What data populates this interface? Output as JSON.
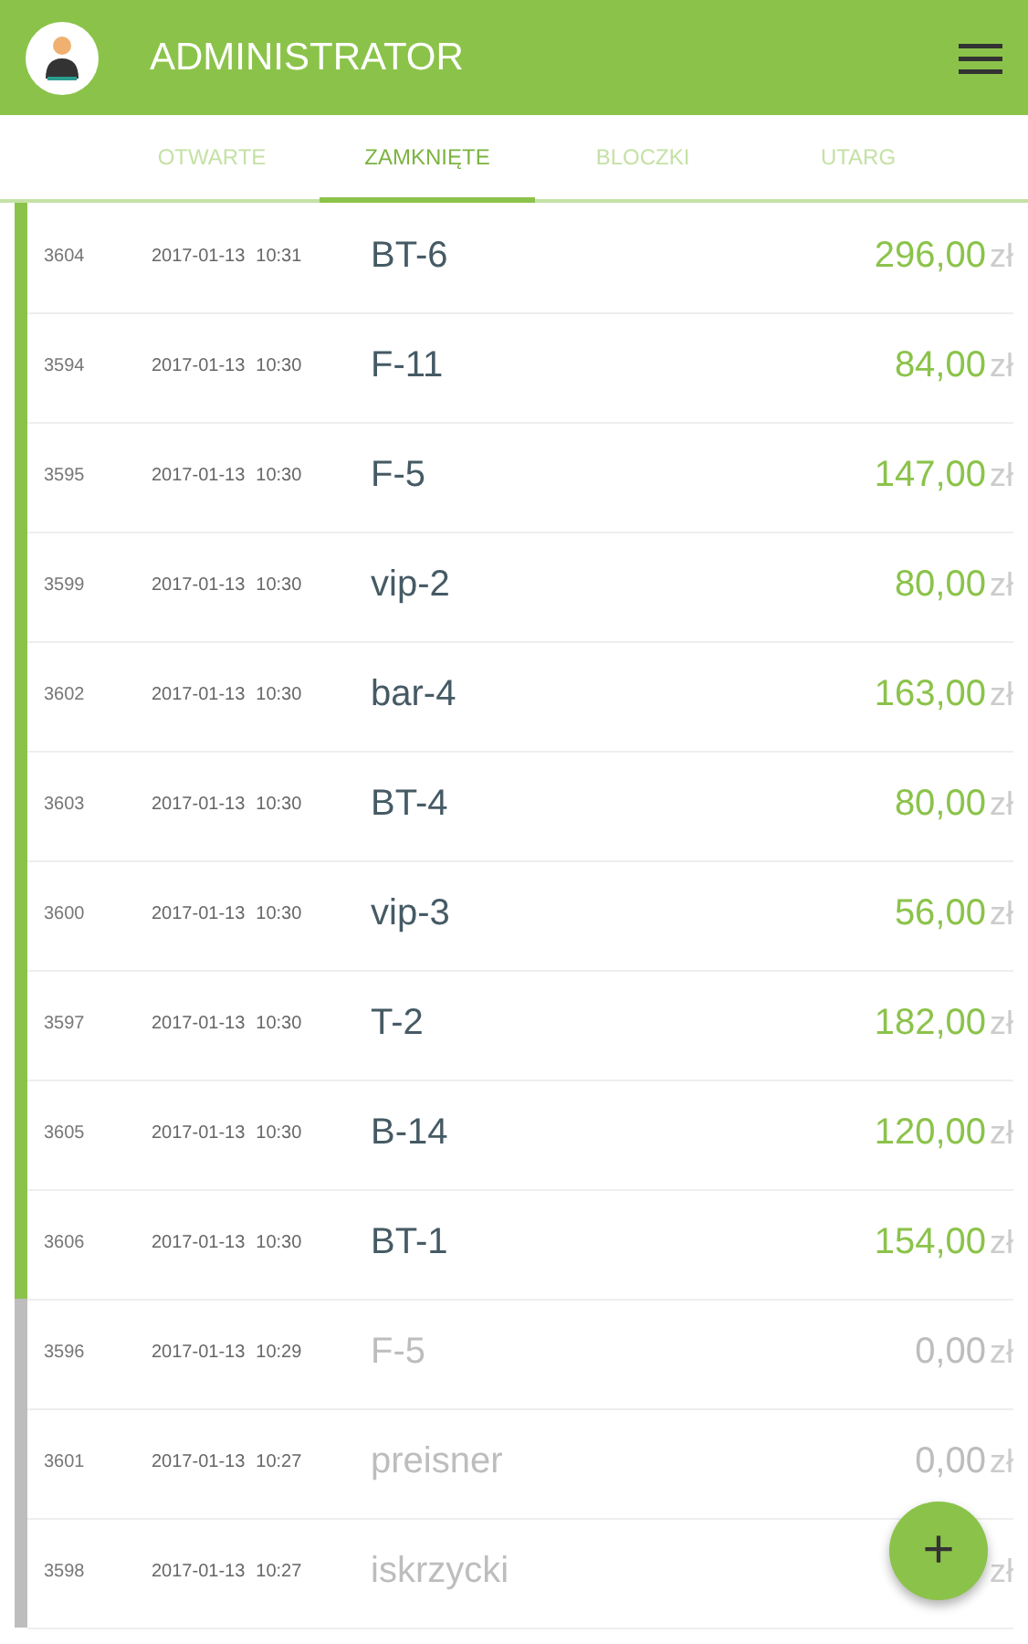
{
  "app_bar": {
    "title": "ADMINISTRATOR"
  },
  "tabs": [
    {
      "label": "OTWARTE",
      "selected": false
    },
    {
      "label": "ZAMKNIĘTE",
      "selected": true
    },
    {
      "label": "BLOCZKI",
      "selected": false
    },
    {
      "label": "UTARG",
      "selected": false
    }
  ],
  "orders": [
    {
      "id": "3604",
      "date": "2017-01-13",
      "time": "10:31",
      "table": "BT-6",
      "amount": "296,00",
      "currency": "zł",
      "settled": true
    },
    {
      "id": "3594",
      "date": "2017-01-13",
      "time": "10:30",
      "table": "F-11",
      "amount": "84,00",
      "currency": "zł",
      "settled": true
    },
    {
      "id": "3595",
      "date": "2017-01-13",
      "time": "10:30",
      "table": "F-5",
      "amount": "147,00",
      "currency": "zł",
      "settled": true
    },
    {
      "id": "3599",
      "date": "2017-01-13",
      "time": "10:30",
      "table": "vip-2",
      "amount": "80,00",
      "currency": "zł",
      "settled": true
    },
    {
      "id": "3602",
      "date": "2017-01-13",
      "time": "10:30",
      "table": "bar-4",
      "amount": "163,00",
      "currency": "zł",
      "settled": true
    },
    {
      "id": "3603",
      "date": "2017-01-13",
      "time": "10:30",
      "table": "BT-4",
      "amount": "80,00",
      "currency": "zł",
      "settled": true
    },
    {
      "id": "3600",
      "date": "2017-01-13",
      "time": "10:30",
      "table": "vip-3",
      "amount": "56,00",
      "currency": "zł",
      "settled": true
    },
    {
      "id": "3597",
      "date": "2017-01-13",
      "time": "10:30",
      "table": "T-2",
      "amount": "182,00",
      "currency": "zł",
      "settled": true
    },
    {
      "id": "3605",
      "date": "2017-01-13",
      "time": "10:30",
      "table": "B-14",
      "amount": "120,00",
      "currency": "zł",
      "settled": true
    },
    {
      "id": "3606",
      "date": "2017-01-13",
      "time": "10:30",
      "table": "BT-1",
      "amount": "154,00",
      "currency": "zł",
      "settled": true
    },
    {
      "id": "3596",
      "date": "2017-01-13",
      "time": "10:29",
      "table": "F-5",
      "amount": "0,00",
      "currency": "zł",
      "settled": false
    },
    {
      "id": "3601",
      "date": "2017-01-13",
      "time": "10:27",
      "table": "preisner",
      "amount": "0,00",
      "currency": "zł",
      "settled": false
    },
    {
      "id": "3598",
      "date": "2017-01-13",
      "time": "10:27",
      "table": "iskrzycki",
      "currency": "zł",
      "settled": false
    }
  ],
  "fab": {
    "label": "+"
  }
}
